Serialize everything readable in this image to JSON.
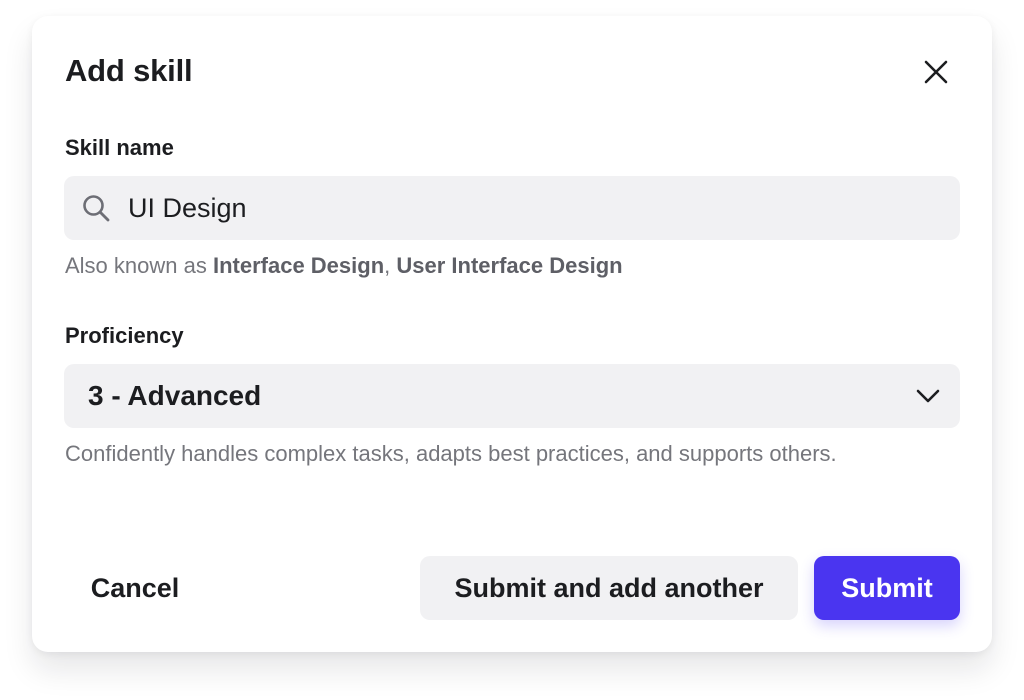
{
  "dialog": {
    "title": "Add skill",
    "close_icon": "close-icon"
  },
  "skill_name": {
    "label": "Skill name",
    "value": "UI Design",
    "icon": "search-icon",
    "aka_prefix": "Also known as ",
    "aka_items": [
      "Interface Design",
      "User Interface Design"
    ],
    "aka_separator": ", "
  },
  "proficiency": {
    "label": "Proficiency",
    "selected": "3 - Advanced",
    "icon": "chevron-down-icon",
    "description": "Confidently handles complex tasks, adapts best practices, and supports others."
  },
  "actions": {
    "cancel": "Cancel",
    "submit_another": "Submit and add another",
    "submit": "Submit"
  },
  "colors": {
    "primary": "#4a35f0",
    "field_bg": "#f1f1f3",
    "muted_text": "#75767c"
  }
}
